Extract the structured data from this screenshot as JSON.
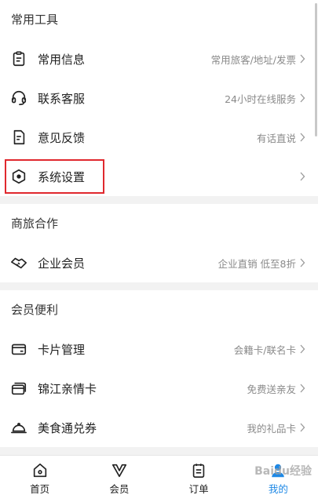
{
  "sections": [
    {
      "title": "常用工具",
      "items": [
        {
          "label": "常用信息",
          "hint": "常用旅客/地址/发票",
          "icon": "clipboard-icon"
        },
        {
          "label": "联系客服",
          "hint": "24小时在线服务",
          "icon": "headset-icon"
        },
        {
          "label": "意见反馈",
          "hint": "有话直说",
          "icon": "feedback-doc-icon"
        },
        {
          "label": "系统设置",
          "hint": "",
          "icon": "settings-hexagon-icon"
        }
      ]
    },
    {
      "title": "商旅合作",
      "items": [
        {
          "label": "企业会员",
          "hint": "企业直销 低至8折",
          "icon": "handshake-icon"
        }
      ]
    },
    {
      "title": "会员便利",
      "items": [
        {
          "label": "卡片管理",
          "hint": "会籍卡/联名卡",
          "icon": "card-icon"
        },
        {
          "label": "锦江亲情卡",
          "hint": "免费送亲友",
          "icon": "gift-cards-icon"
        },
        {
          "label": "美食通兑券",
          "hint": "我的礼品卡",
          "icon": "cloche-icon"
        }
      ]
    }
  ],
  "tabbar": [
    {
      "label": "首页",
      "icon": "home-icon",
      "active": false
    },
    {
      "label": "会员",
      "icon": "vip-v-icon",
      "active": false
    },
    {
      "label": "订单",
      "icon": "order-list-icon",
      "active": false
    },
    {
      "label": "我的",
      "icon": "user-icon",
      "active": true
    }
  ],
  "watermark": "Baidu经验",
  "colors": {
    "accent": "#1e88e5",
    "highlight": "#e0282e"
  }
}
